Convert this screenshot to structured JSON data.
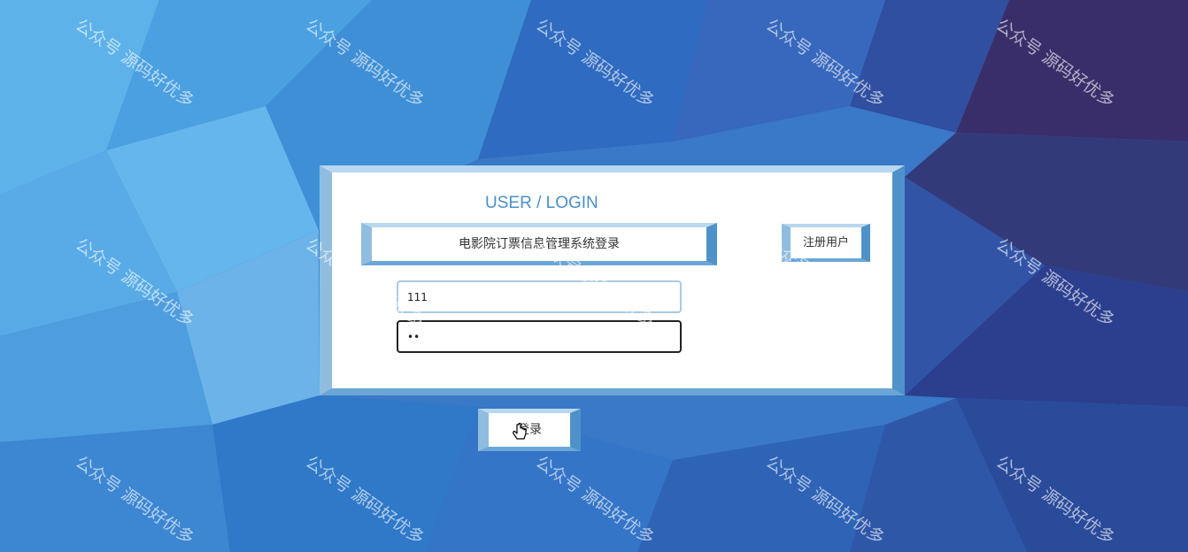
{
  "login": {
    "title": "USER / LOGIN",
    "system_title": "电影院订票信息管理系统登录",
    "register_label": "注册用户",
    "username_value": "111",
    "password_value": "••",
    "login_label": "登录"
  },
  "watermark_text": "公众号 源码好优多",
  "colors": {
    "background": "#2f6fc4",
    "frame": "#6aa6d6",
    "title": "#4a8fc9"
  }
}
